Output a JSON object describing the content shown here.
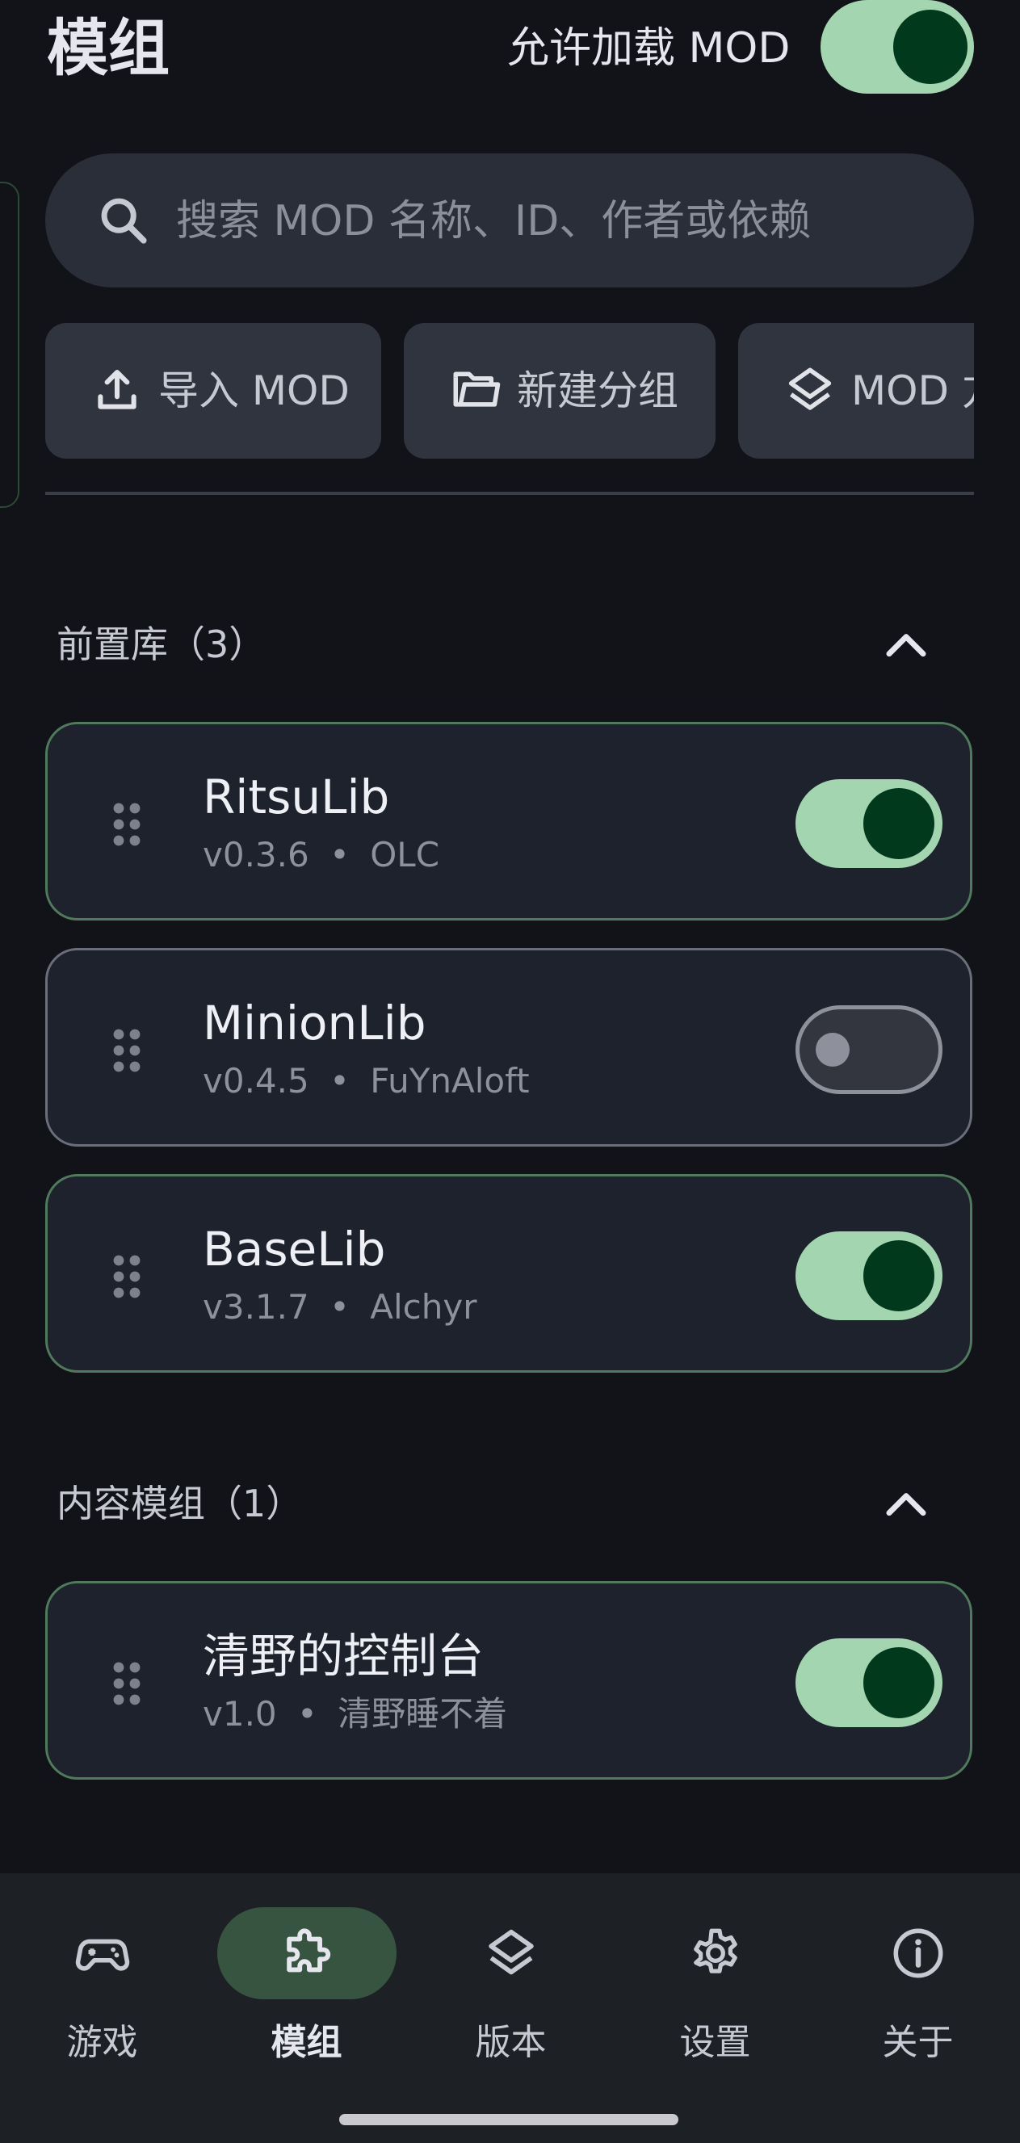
{
  "header": {
    "title": "模组",
    "allow_label": "允许加载 MOD",
    "allow_enabled": true
  },
  "search": {
    "placeholder": "搜索 MOD 名称、ID、作者或依赖",
    "value": "",
    "icon": "search-icon"
  },
  "actions": [
    {
      "label": "导入 MOD",
      "icon": "upload-icon"
    },
    {
      "label": "新建分组",
      "icon": "folder-icon"
    },
    {
      "label": "MOD 方",
      "icon": "layers-icon"
    }
  ],
  "sections": [
    {
      "title": "前置库（3）",
      "expanded": true,
      "mods": [
        {
          "name": "RitsuLib",
          "version": "v0.3.6",
          "sep": "•",
          "author": "OLC",
          "enabled": true
        },
        {
          "name": "MinionLib",
          "version": "v0.4.5",
          "sep": "•",
          "author": "FuYnAloft",
          "enabled": false
        },
        {
          "name": "BaseLib",
          "version": "v3.1.7",
          "sep": "•",
          "author": "Alchyr",
          "enabled": true
        }
      ]
    },
    {
      "title": "内容模组（1）",
      "expanded": true,
      "mods": [
        {
          "name": "清野的控制台",
          "version": "v1.0",
          "sep": "•",
          "author": "清野睡不着",
          "enabled": true
        }
      ]
    }
  ],
  "nav": {
    "items": [
      {
        "label": "游戏",
        "icon": "gamepad-icon",
        "active": false
      },
      {
        "label": "模组",
        "icon": "puzzle-icon",
        "active": true
      },
      {
        "label": "版本",
        "icon": "layers-icon",
        "active": false
      },
      {
        "label": "设置",
        "icon": "gear-icon",
        "active": false
      },
      {
        "label": "关于",
        "icon": "info-icon",
        "active": false
      }
    ]
  },
  "colors": {
    "background": "#111318",
    "switch_on_track": "#a3d6b0",
    "switch_on_knob": "#00391c",
    "card_on_border": "#4f7a5b",
    "nav_active_pill": "#375440"
  }
}
